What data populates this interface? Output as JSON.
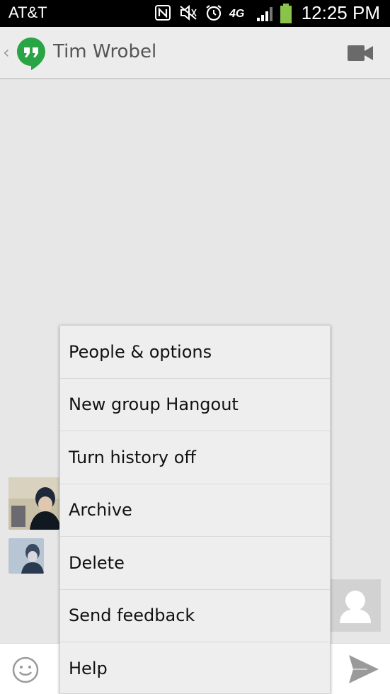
{
  "status_bar": {
    "carrier": "AT&T",
    "time": "12:25 PM",
    "icons": [
      "nfc-icon",
      "mute-icon",
      "alarm-icon",
      "4g-lte-icon",
      "signal-icon",
      "battery-icon"
    ],
    "network_label": "4G"
  },
  "action_bar": {
    "title": "Tim Wrobel",
    "app_icon": "hangouts-logo-icon",
    "video_icon": "video-call-icon"
  },
  "menu": {
    "items": [
      {
        "label": "People & options"
      },
      {
        "label": "New group Hangout"
      },
      {
        "label": "Turn history off"
      },
      {
        "label": "Archive"
      },
      {
        "label": "Delete"
      },
      {
        "label": "Send feedback"
      },
      {
        "label": "Help"
      }
    ]
  },
  "colors": {
    "hangouts_green": "#2aa545",
    "background": "#e7e7e7",
    "menu_bg": "#eeeeee"
  }
}
